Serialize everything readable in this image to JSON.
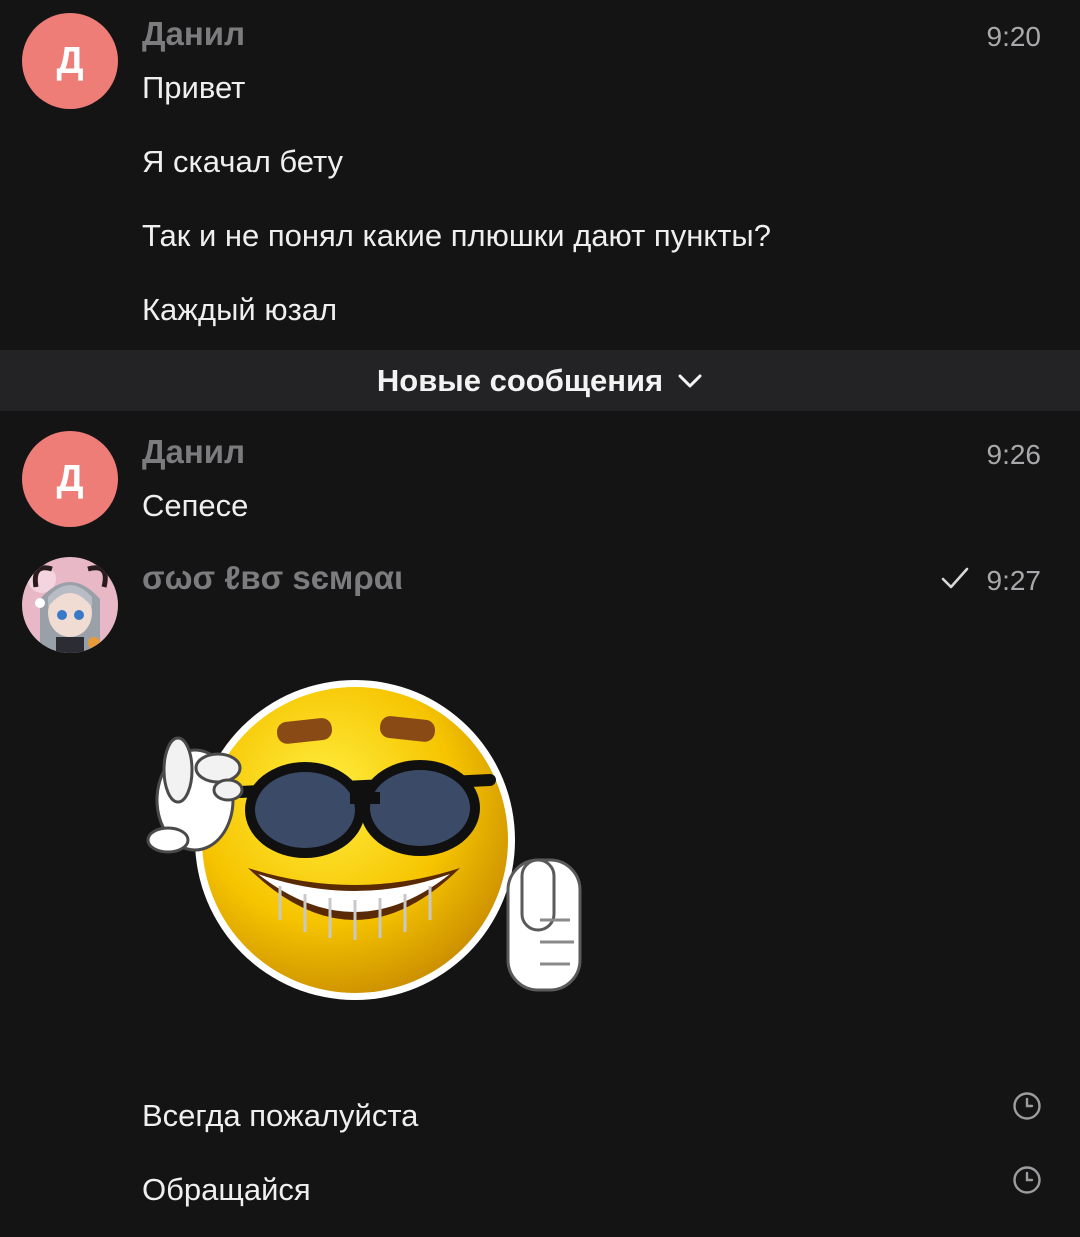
{
  "messages": [
    {
      "author": "Данил",
      "avatar_letter": "Д",
      "avatar_color": "#ee7c77",
      "time": "9:20",
      "lines": [
        "Привет",
        "Я скачал бету",
        "Так и не понял какие плюшки дают пункты?",
        "Каждый юзал"
      ]
    },
    {
      "author": "Данил",
      "avatar_letter": "Д",
      "avatar_color": "#ee7c77",
      "time": "9:26",
      "lines": [
        "Сепесе"
      ]
    },
    {
      "author": "σωσ ℓвσ ѕємραι",
      "time": "9:27",
      "status_icon": "check-icon",
      "sticker": "cool-smiley-thumbs-up-sticker",
      "lines": [
        "Всегда пожалуйста",
        "Обращайся"
      ],
      "pending_icon": "clock-icon"
    }
  ],
  "divider": {
    "label": "Новые сообщения",
    "icon": "chevron-down-icon"
  },
  "colors": {
    "background": "#141415",
    "divider_bg": "#232325",
    "author_name": "#7c7c7f",
    "timestamp": "#a9a9ac",
    "text": "#efefef"
  }
}
